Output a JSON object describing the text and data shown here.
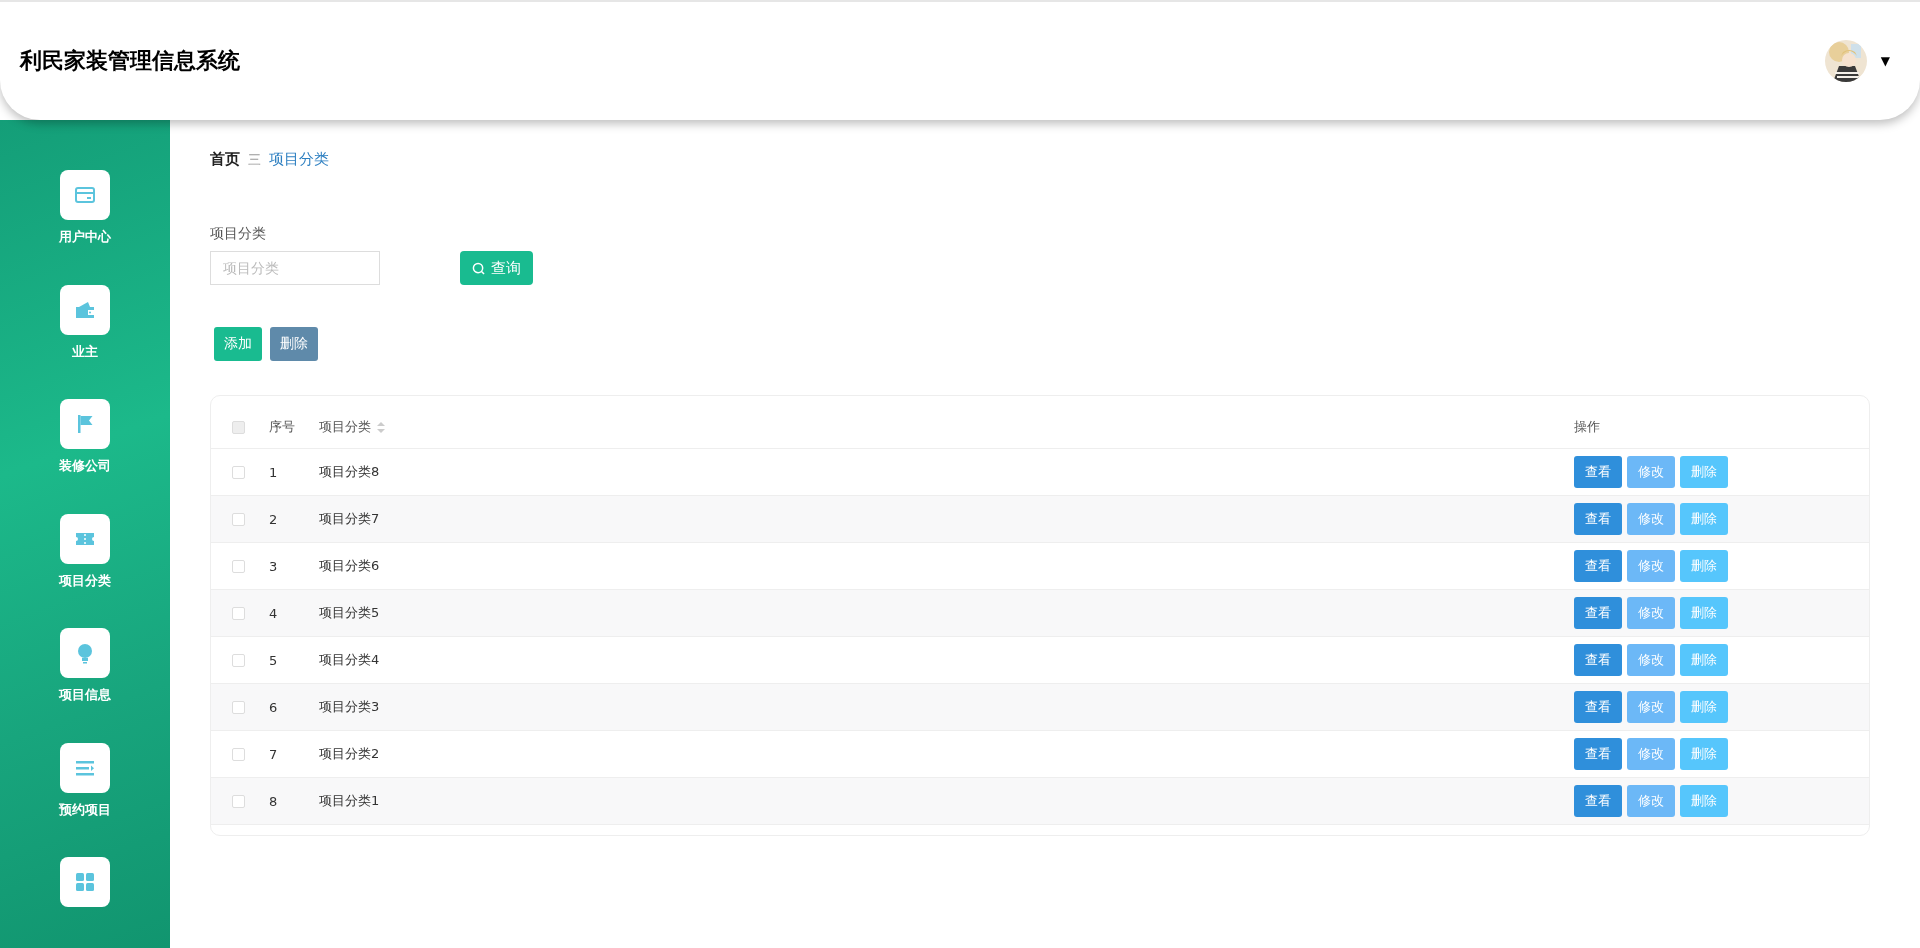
{
  "header": {
    "title": "利民家装管理信息系统",
    "user_menu_caret": "▼"
  },
  "sidebar": {
    "items": [
      {
        "kind": "card",
        "label": "用户中心"
      },
      {
        "kind": "wallet",
        "label": "业主"
      },
      {
        "kind": "flag",
        "label": "装修公司"
      },
      {
        "kind": "ticket",
        "label": "项目分类"
      },
      {
        "kind": "bulb",
        "label": "项目信息"
      },
      {
        "kind": "list",
        "label": "预约项目"
      },
      {
        "kind": "grid"
      }
    ]
  },
  "breadcrumb": {
    "home": "首页",
    "separator": "三",
    "current": "项目分类"
  },
  "search": {
    "label": "项目分类",
    "placeholder": "项目分类",
    "button": "查询"
  },
  "actions": {
    "add": "添加",
    "delete": "删除"
  },
  "table": {
    "select_all": {
      "checked": false
    },
    "columns": [
      "序号",
      "项目分类",
      "操作"
    ],
    "rows": [
      {
        "checked": false,
        "index": "1",
        "name": "项目分类8",
        "buttons": [
          "查看",
          "修改",
          "删除"
        ]
      },
      {
        "checked": false,
        "index": "2",
        "name": "项目分类7",
        "buttons": [
          "查看",
          "修改",
          "删除"
        ]
      },
      {
        "checked": false,
        "index": "3",
        "name": "项目分类6",
        "buttons": [
          "查看",
          "修改",
          "删除"
        ]
      },
      {
        "checked": false,
        "index": "4",
        "name": "项目分类5",
        "buttons": [
          "查看",
          "修改",
          "删除"
        ]
      },
      {
        "checked": false,
        "index": "5",
        "name": "项目分类4",
        "buttons": [
          "查看",
          "修改",
          "删除"
        ]
      },
      {
        "checked": false,
        "index": "6",
        "name": "项目分类3",
        "buttons": [
          "查看",
          "修改",
          "删除"
        ]
      },
      {
        "checked": false,
        "index": "7",
        "name": "项目分类2",
        "buttons": [
          "查看",
          "修改",
          "删除"
        ]
      },
      {
        "checked": false,
        "index": "8",
        "name": "项目分类1",
        "buttons": [
          "查看",
          "修改",
          "删除"
        ]
      }
    ]
  }
}
